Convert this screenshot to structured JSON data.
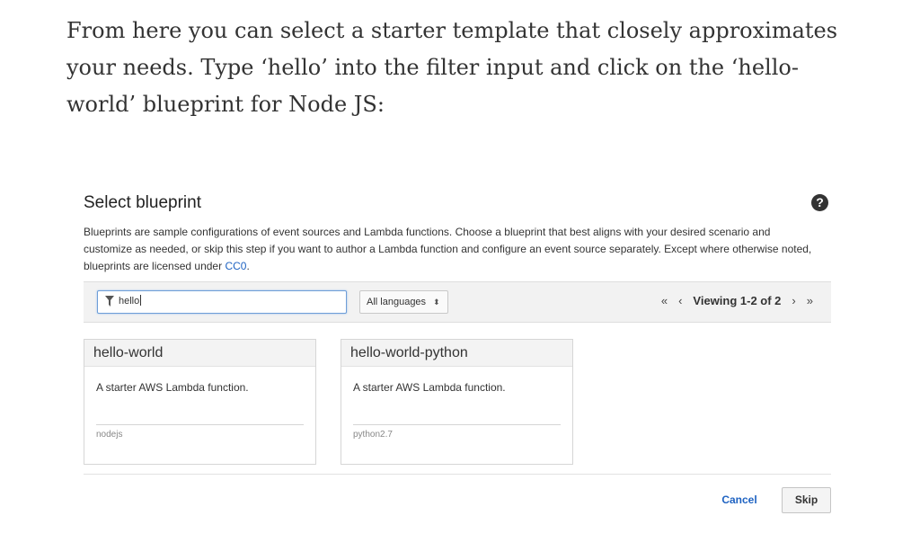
{
  "intro": {
    "text": "From here you can select a starter template that closely approximates your needs. Type ‘hello’ into the filter input and click on the ‘hello-world’ blueprint for Node JS:"
  },
  "blueprint": {
    "title": "Select blueprint",
    "help_icon": "question-circle-icon",
    "description": "Blueprints are sample configurations of event sources and Lambda functions. Choose a blueprint that best aligns with your desired scenario and customize as needed, or skip this step if you want to author a Lambda function and configure an event source separately. Except where otherwise noted, blueprints are licensed under ",
    "license_link": "CC0",
    "description_end": ".",
    "filter": {
      "value": "hello",
      "icon": "filter-icon"
    },
    "language_select": {
      "selected": "All languages"
    },
    "pager": {
      "first": "«",
      "prev": "‹",
      "text": "Viewing 1-2 of 2",
      "next": "›",
      "last": "»"
    },
    "cards": [
      {
        "name": "hello-world",
        "description": "A starter AWS Lambda function.",
        "runtime": "nodejs"
      },
      {
        "name": "hello-world-python",
        "description": "A starter AWS Lambda function.",
        "runtime": "python2.7"
      }
    ]
  },
  "actions": {
    "cancel": "Cancel",
    "skip": "Skip"
  }
}
